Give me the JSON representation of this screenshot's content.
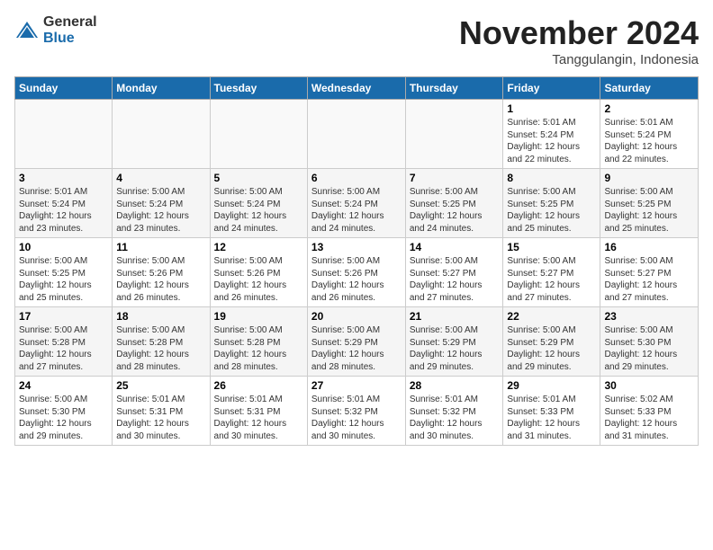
{
  "header": {
    "logo_general": "General",
    "logo_blue": "Blue",
    "month_title": "November 2024",
    "subtitle": "Tanggulangin, Indonesia"
  },
  "weekdays": [
    "Sunday",
    "Monday",
    "Tuesday",
    "Wednesday",
    "Thursday",
    "Friday",
    "Saturday"
  ],
  "weeks": [
    [
      {
        "day": "",
        "info": ""
      },
      {
        "day": "",
        "info": ""
      },
      {
        "day": "",
        "info": ""
      },
      {
        "day": "",
        "info": ""
      },
      {
        "day": "",
        "info": ""
      },
      {
        "day": "1",
        "info": "Sunrise: 5:01 AM\nSunset: 5:24 PM\nDaylight: 12 hours\nand 22 minutes."
      },
      {
        "day": "2",
        "info": "Sunrise: 5:01 AM\nSunset: 5:24 PM\nDaylight: 12 hours\nand 22 minutes."
      }
    ],
    [
      {
        "day": "3",
        "info": "Sunrise: 5:01 AM\nSunset: 5:24 PM\nDaylight: 12 hours\nand 23 minutes."
      },
      {
        "day": "4",
        "info": "Sunrise: 5:00 AM\nSunset: 5:24 PM\nDaylight: 12 hours\nand 23 minutes."
      },
      {
        "day": "5",
        "info": "Sunrise: 5:00 AM\nSunset: 5:24 PM\nDaylight: 12 hours\nand 24 minutes."
      },
      {
        "day": "6",
        "info": "Sunrise: 5:00 AM\nSunset: 5:24 PM\nDaylight: 12 hours\nand 24 minutes."
      },
      {
        "day": "7",
        "info": "Sunrise: 5:00 AM\nSunset: 5:25 PM\nDaylight: 12 hours\nand 24 minutes."
      },
      {
        "day": "8",
        "info": "Sunrise: 5:00 AM\nSunset: 5:25 PM\nDaylight: 12 hours\nand 25 minutes."
      },
      {
        "day": "9",
        "info": "Sunrise: 5:00 AM\nSunset: 5:25 PM\nDaylight: 12 hours\nand 25 minutes."
      }
    ],
    [
      {
        "day": "10",
        "info": "Sunrise: 5:00 AM\nSunset: 5:25 PM\nDaylight: 12 hours\nand 25 minutes."
      },
      {
        "day": "11",
        "info": "Sunrise: 5:00 AM\nSunset: 5:26 PM\nDaylight: 12 hours\nand 26 minutes."
      },
      {
        "day": "12",
        "info": "Sunrise: 5:00 AM\nSunset: 5:26 PM\nDaylight: 12 hours\nand 26 minutes."
      },
      {
        "day": "13",
        "info": "Sunrise: 5:00 AM\nSunset: 5:26 PM\nDaylight: 12 hours\nand 26 minutes."
      },
      {
        "day": "14",
        "info": "Sunrise: 5:00 AM\nSunset: 5:27 PM\nDaylight: 12 hours\nand 27 minutes."
      },
      {
        "day": "15",
        "info": "Sunrise: 5:00 AM\nSunset: 5:27 PM\nDaylight: 12 hours\nand 27 minutes."
      },
      {
        "day": "16",
        "info": "Sunrise: 5:00 AM\nSunset: 5:27 PM\nDaylight: 12 hours\nand 27 minutes."
      }
    ],
    [
      {
        "day": "17",
        "info": "Sunrise: 5:00 AM\nSunset: 5:28 PM\nDaylight: 12 hours\nand 27 minutes."
      },
      {
        "day": "18",
        "info": "Sunrise: 5:00 AM\nSunset: 5:28 PM\nDaylight: 12 hours\nand 28 minutes."
      },
      {
        "day": "19",
        "info": "Sunrise: 5:00 AM\nSunset: 5:28 PM\nDaylight: 12 hours\nand 28 minutes."
      },
      {
        "day": "20",
        "info": "Sunrise: 5:00 AM\nSunset: 5:29 PM\nDaylight: 12 hours\nand 28 minutes."
      },
      {
        "day": "21",
        "info": "Sunrise: 5:00 AM\nSunset: 5:29 PM\nDaylight: 12 hours\nand 29 minutes."
      },
      {
        "day": "22",
        "info": "Sunrise: 5:00 AM\nSunset: 5:29 PM\nDaylight: 12 hours\nand 29 minutes."
      },
      {
        "day": "23",
        "info": "Sunrise: 5:00 AM\nSunset: 5:30 PM\nDaylight: 12 hours\nand 29 minutes."
      }
    ],
    [
      {
        "day": "24",
        "info": "Sunrise: 5:00 AM\nSunset: 5:30 PM\nDaylight: 12 hours\nand 29 minutes."
      },
      {
        "day": "25",
        "info": "Sunrise: 5:01 AM\nSunset: 5:31 PM\nDaylight: 12 hours\nand 30 minutes."
      },
      {
        "day": "26",
        "info": "Sunrise: 5:01 AM\nSunset: 5:31 PM\nDaylight: 12 hours\nand 30 minutes."
      },
      {
        "day": "27",
        "info": "Sunrise: 5:01 AM\nSunset: 5:32 PM\nDaylight: 12 hours\nand 30 minutes."
      },
      {
        "day": "28",
        "info": "Sunrise: 5:01 AM\nSunset: 5:32 PM\nDaylight: 12 hours\nand 30 minutes."
      },
      {
        "day": "29",
        "info": "Sunrise: 5:01 AM\nSunset: 5:33 PM\nDaylight: 12 hours\nand 31 minutes."
      },
      {
        "day": "30",
        "info": "Sunrise: 5:02 AM\nSunset: 5:33 PM\nDaylight: 12 hours\nand 31 minutes."
      }
    ]
  ]
}
